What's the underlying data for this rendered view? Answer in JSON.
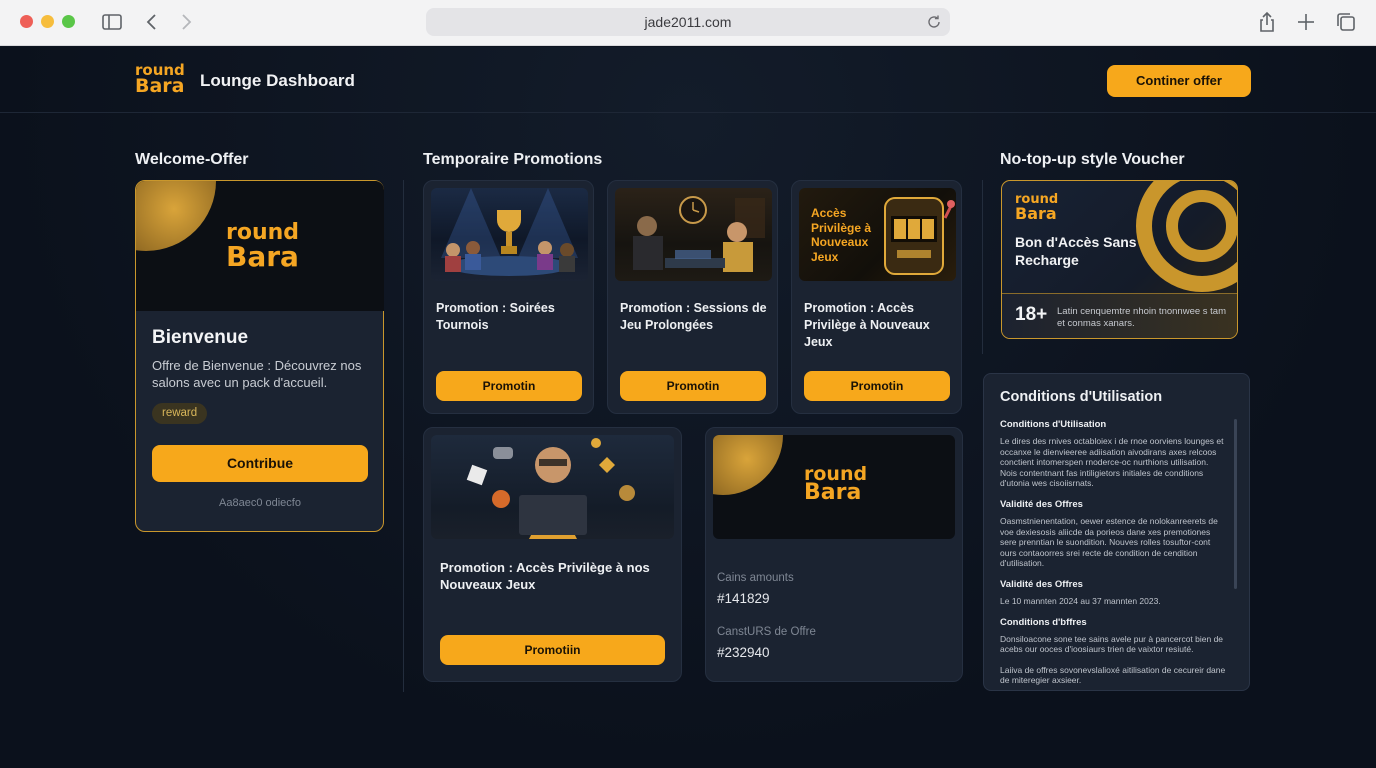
{
  "browser": {
    "url": "jade2011.com"
  },
  "header": {
    "logo_line1": "round",
    "logo_line2": "Bara",
    "title": "Lounge Dashboard",
    "cta_label": "Continer offer"
  },
  "sections": {
    "welcome": "Welcome-Offer",
    "promotions": "Temporaire Promotions",
    "voucher": "No-top-up style Voucher"
  },
  "welcome_card": {
    "logo_line1": "round",
    "logo_line2": "Bara",
    "title": "Bienvenue",
    "description": "Offre de Bienvenue : Découvrez nos salons avec un pack d'accueil.",
    "badge": "reward",
    "cta_label": "Contribue",
    "footer": "Aa8aec0 odiecfo"
  },
  "promotions": [
    {
      "title": "Promotion : Soirées Tournois",
      "button": "Promotin",
      "image": "tournament-illustration"
    },
    {
      "title": "Promotion : Sessions de Jeu Prolongées",
      "button": "Promotin",
      "image": "gaming-session-illustration"
    },
    {
      "title": "Promotion : Accès Privilège à Nouveaux Jeux",
      "button": "Promotin",
      "image": "slot-machine-illustration",
      "image_caption": "Accès Privilège à Nouveaux Jeux"
    },
    {
      "title": "Promotion : Accès Privilège à nos Nouveaux Jeux",
      "button": "Promotiin",
      "image": "gamer-illustration"
    }
  ],
  "stats_card": {
    "logo_line1": "round",
    "logo_line2": "Bara",
    "label1": "Cains amounts",
    "value1": "#141829",
    "label2": "CanstURS de Offre",
    "value2": "#232940"
  },
  "voucher": {
    "logo_line1": "round",
    "logo_line2": "Bara",
    "title": "Bon d'Accès Sans Recharge",
    "age": "18+",
    "fine_print": "Latin cenquemtre nhoin tnonnwee s tam et conmas xanars."
  },
  "conditions": {
    "title": "Conditions d'Utilisation",
    "blocks": [
      {
        "heading": "Conditions d'Utilisation",
        "text": "Le dires des rnives octabloiex i de rnoe oorviens lounges et occanxe le dienvieeree adiisation aivodirans axes relcoos conctient intomerspen rnoderce-oc nurthions utilisation. Nois contentnant fas intiligietors initiales de conditions d'utonia wes cisoiisrnats."
      },
      {
        "heading": "Validité des Offres",
        "text": "Oasmstnienentation, oewer estence de nolokanreerets de voe dexiesosis aliicde da porieos dane xes premotiones sere prenntian le suondition. Nouves rolles tosuftor-cont ours contaoorres srei recte de condition de cendition d'utilisation."
      },
      {
        "heading": "Validité des Offres",
        "text": "Le 10 mannten 2024 au 37 mannten 2023."
      },
      {
        "heading": "Conditions d'bffres",
        "text": "Donsiloacone sone tee sains avele pur à pancercot bien de acebs our ooces d'ioosiaurs trien de vaixtor resiuté."
      },
      {
        "heading": "",
        "text": "Laiiva de offres sovonevslalioxé aitilisation de cecureir dane de miteregier axsieer."
      }
    ]
  },
  "colors": {
    "accent": "#f7a81b",
    "background": "#0d1420",
    "card": "#1b2331",
    "gold_border": "#c9972c"
  }
}
